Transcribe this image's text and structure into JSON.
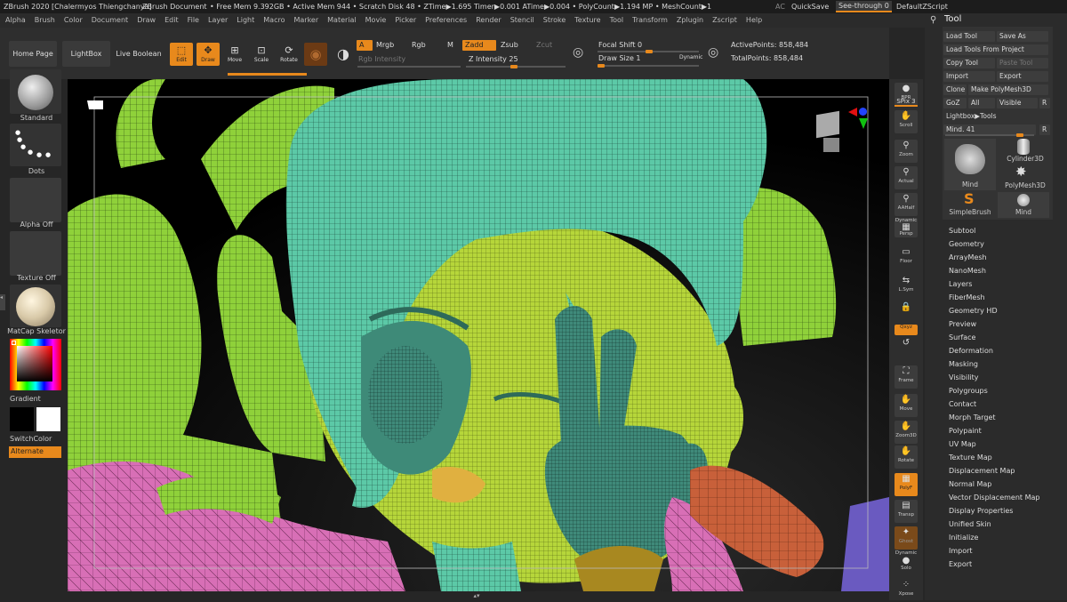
{
  "titlebar": {
    "app": "ZBrush 2020 [Chalermyos Thiengchanya]",
    "document": "ZBrush Document",
    "stats": "• Free Mem 9.392GB • Active Mem 944 • Scratch Disk 48 • ZTime▶1.695 Timer▶0.001 ATime▶0.004 • PolyCount▶1.194 MP • MeshCount▶1",
    "ac": "AC",
    "quicksave": "QuickSave",
    "seethrough": "See-through 0",
    "script": "DefaultZScript"
  },
  "menu": [
    "Alpha",
    "Brush",
    "Color",
    "Document",
    "Draw",
    "Edit",
    "File",
    "Layer",
    "Light",
    "Macro",
    "Marker",
    "Material",
    "Movie",
    "Picker",
    "Preferences",
    "Render",
    "Stencil",
    "Stroke",
    "Texture",
    "Tool",
    "Transform",
    "Zplugin",
    "Zscript",
    "Help"
  ],
  "shelf": {
    "home": "Home Page",
    "lightbox": "LightBox",
    "liveboolean": "Live Boolean",
    "edit": "Edit",
    "draw": "Draw",
    "move": "Move",
    "scale": "Scale",
    "rotate": "Rotate",
    "a": "A",
    "mrgb": "Mrgb",
    "rgb": "Rgb",
    "m": "M",
    "rgbintensity": "Rgb Intensity",
    "zadd": "Zadd",
    "zsub": "Zsub",
    "zcut": "Zcut",
    "zintensity": "Z Intensity 25",
    "focal": "Focal Shift 0",
    "drawsize": "Draw Size 1",
    "dynamic": "Dynamic",
    "activepoints": "ActivePoints: 858,484",
    "totalpoints": "TotalPoints: 858,484"
  },
  "left": {
    "brush": "Standard",
    "stroke": "Dots",
    "alpha": "Alpha Off",
    "texture": "Texture Off",
    "material": "MatCap Skeletor",
    "gradient": "Gradient",
    "switchcolor": "SwitchColor",
    "alternate": "Alternate"
  },
  "right": {
    "bpr": "BPR",
    "spix": "SPix 3",
    "scroll": "Scroll",
    "zoom": "Zoom",
    "actual": "Actual",
    "aahalf": "AAHalf",
    "dynamic": "Dynamic",
    "persp": "Persp",
    "floor": "Floor",
    "lsym": "L.Sym",
    "xyz": "Qxyz",
    "frame": "Frame",
    "move": "Move",
    "zoom3d": "Zoom3D",
    "rotate": "Rotate",
    "polyf": "PolyF",
    "transp": "Transp",
    "ghost": "Ghost",
    "dynamic2": "Dynamic",
    "solo": "Solo",
    "xpose": "Xpose"
  },
  "tool": {
    "title": "Tool",
    "load": "Load Tool",
    "saveas": "Save As",
    "loadproj": "Load Tools From Project",
    "copy": "Copy Tool",
    "paste": "Paste Tool",
    "import": "Import",
    "export": "Export",
    "clone": "Clone",
    "makepm": "Make PolyMesh3D",
    "goz": "GoZ",
    "all": "All",
    "visible": "Visible",
    "r": "R",
    "lightbox": "Lightbox▶Tools",
    "mind": "Mind. 41",
    "r2": "R",
    "thumbs": [
      "Mind",
      "Cylinder3D",
      "PolyMesh3D",
      "SimpleBrush",
      "Mind"
    ]
  },
  "toolmenu": [
    "Subtool",
    "Geometry",
    "ArrayMesh",
    "NanoMesh",
    "Layers",
    "FiberMesh",
    "Geometry HD",
    "Preview",
    "Surface",
    "Deformation",
    "Masking",
    "Visibility",
    "Polygroups",
    "Contact",
    "Morph Target",
    "Polypaint",
    "UV Map",
    "Texture Map",
    "Displacement Map",
    "Normal Map",
    "Vector Displacement Map",
    "Display Properties",
    "Unified Skin",
    "Initialize",
    "Import",
    "Export"
  ]
}
